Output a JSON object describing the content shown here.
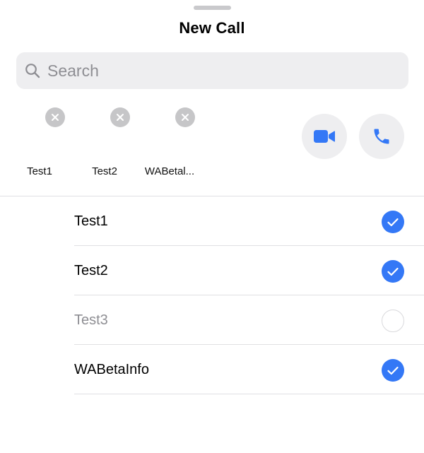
{
  "header": {
    "title": "New Call"
  },
  "search": {
    "placeholder": "Search"
  },
  "selected_chips": [
    {
      "label": "Test1"
    },
    {
      "label": "Test2"
    },
    {
      "label": "WABetal..."
    }
  ],
  "call_actions": {
    "video_icon": "video-camera-icon",
    "voice_icon": "phone-icon"
  },
  "contacts": [
    {
      "name": "Test1",
      "checked": true,
      "disabled": false
    },
    {
      "name": "Test2",
      "checked": true,
      "disabled": false
    },
    {
      "name": "Test3",
      "checked": false,
      "disabled": true
    },
    {
      "name": "WABetaInfo",
      "checked": true,
      "disabled": false
    }
  ],
  "colors": {
    "accent": "#3478f6",
    "chip_remove_bg": "#c6c6c8",
    "search_bg": "#eeeef0",
    "placeholder": "#8e8e93"
  }
}
